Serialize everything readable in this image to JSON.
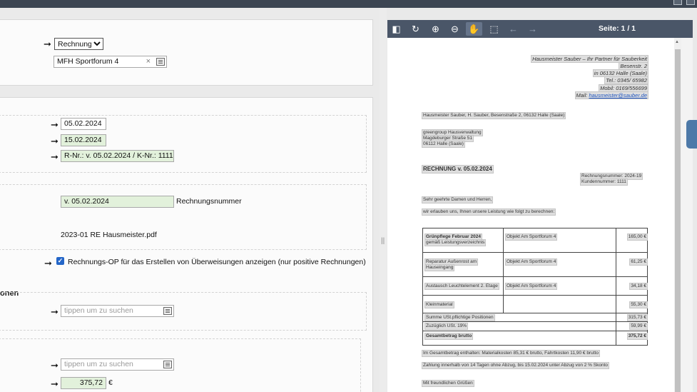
{
  "form": {
    "doc_type": {
      "selected": "Rechnung",
      "options": [
        "Rechnung"
      ]
    },
    "property": {
      "value": "MFH Sportforum 4"
    },
    "date1": "05.02.2024",
    "date2": "15.02.2024",
    "reference": "R-Nr.: v. 05.02.2024 / K-Nr.: 1111",
    "invoice_number_field": "v. 05.02.2024",
    "invoice_number_label": "Rechnungsnummer",
    "filename": "2023-01 RE Hausmeister.pdf",
    "checkbox_label": "Rechnungs-OP für das Erstellen von Überweisungen anzeigen (nur positive Rechnungen)",
    "section_heading": "onen",
    "search1_placeholder": "tippen um zu suchen",
    "search2_placeholder": "tippen um zu suchen",
    "amount": "375,72",
    "currency": "€"
  },
  "viewer": {
    "page_info": "Seite: 1 / 1",
    "icons": [
      "sidebar-toggle-icon",
      "rotate-icon",
      "zoom-in-icon",
      "zoom-out-icon",
      "hand-tool-icon",
      "select-tool-icon",
      "previous-page-icon",
      "next-page-icon"
    ]
  },
  "document": {
    "sender": [
      "Hausmeister Sauber – Ihr Partner für Sauberkeit",
      "Besenstr. 2",
      "in 06132 Halle (Saale)",
      "Tel.: 0345/ 65982",
      "Mobil: 0169/556699"
    ],
    "mail_label": "Mail:",
    "mail_link": "hausmeister@sauber.de",
    "return_line": "Hausmeister Sauber, H. Sauber, Besenstraße 2, 06132 Halle (Saale)",
    "recipient": [
      "greengroup Hausverwaltung",
      "Magdeburger Straße 51",
      "06112 Halle (Saale)"
    ],
    "title": "RECHNUNG v. 05.02.2024",
    "meta": [
      "Rechnungsnummer: 2024-19",
      "Kundennummer: 1111"
    ],
    "greeting": "Sehr geehrte Damen und Herren,",
    "intro": "wir erlauben uns, Ihnen unsere Leistung wie folgt zu berechnen:",
    "items": [
      {
        "desc": "Grünpflege Februar 2024",
        "sub": "gemäß Leistungsverzeichnis",
        "obj": "Objekt Am Sportforum 4",
        "price": "165,00 €"
      },
      {
        "desc": "Reparatur Außenrost am",
        "sub": "Hauseingang",
        "obj": "Objekt Am Sportforum 4",
        "price": "61,25 €"
      },
      {
        "desc": "Austausch Leuchtelement 2. Etage",
        "sub": "",
        "obj": "Objekt Am Sportforum 4",
        "price": "34,18 €"
      },
      {
        "desc": "Kleinmaterial",
        "sub": "",
        "obj": "",
        "price": "55,30 €"
      }
    ],
    "sum_label": "Summe USt.pflichtige Positionen",
    "sum_value": "315,73 €",
    "vat_label": "Zuzüglich USt. 19%",
    "vat_value": "59,99 €",
    "total_label": "Gesamtbetrag brutto",
    "total_value": "375,72 €",
    "note1": "Im Gesamtbetrag enthalten: Materialkosten 85,31 € brutto, Fahrtkosten 11,90 € brutto",
    "note2": "Zahlung innerhalb von 14 Tagen ohne Abzug, bis 15.02.2024 unter Abzug von 2 % Skonto",
    "closing": "Mit freundlichen Grüßen"
  }
}
